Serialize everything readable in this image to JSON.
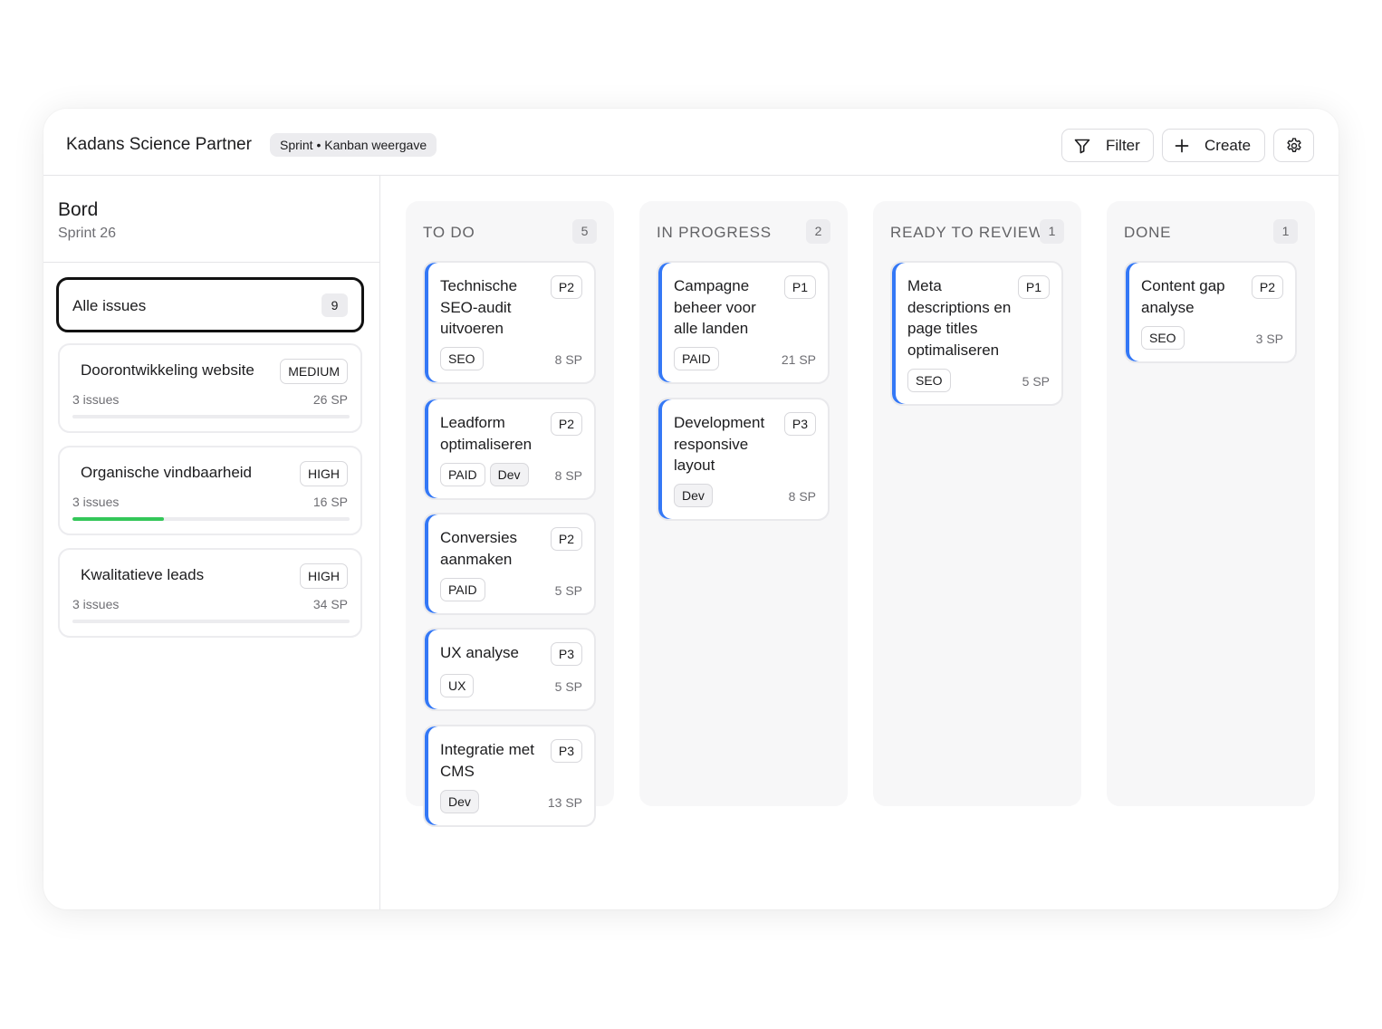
{
  "header": {
    "app_title": "Kadans Science Partner",
    "view_badge": "Sprint • Kanban weergave",
    "filter_label": "Filter",
    "create_label": "Create"
  },
  "sidebar": {
    "title": "Bord",
    "subtitle": "Sprint 26",
    "all_issues": {
      "label": "Alle issues",
      "count": "9"
    },
    "epics": [
      {
        "name": "Doorontwikkeling website",
        "priority": "MEDIUM",
        "issues": "3 issues",
        "sp": "26 SP",
        "progress": 0.0
      },
      {
        "name": "Organische vindbaarheid",
        "priority": "HIGH",
        "issues": "3 issues",
        "sp": "16 SP",
        "progress": 0.33
      },
      {
        "name": "Kwalitatieve leads",
        "priority": "HIGH",
        "issues": "3 issues",
        "sp": "34 SP",
        "progress": 0.0
      }
    ]
  },
  "board": {
    "accent_color": "#3478f6",
    "progress_color": "#34c759",
    "columns": [
      {
        "title": "TO DO",
        "count": "5",
        "cards": [
          {
            "title": "Technische SEO-audit uitvoeren",
            "priority": "P2",
            "tags": [
              "SEO"
            ],
            "sp": "8 SP"
          },
          {
            "title": "Leadform optimaliseren",
            "priority": "P2",
            "tags": [
              "PAID",
              "Dev"
            ],
            "sp": "8 SP"
          },
          {
            "title": "Conversies aanmaken",
            "priority": "P2",
            "tags": [
              "PAID"
            ],
            "sp": "5 SP"
          },
          {
            "title": "UX analyse",
            "priority": "P3",
            "tags": [
              "UX"
            ],
            "sp": "5 SP"
          },
          {
            "title": "Integratie met CMS",
            "priority": "P3",
            "tags": [
              "Dev"
            ],
            "sp": "13 SP"
          }
        ]
      },
      {
        "title": "IN PROGRESS",
        "count": "2",
        "cards": [
          {
            "title": "Campagne beheer voor alle landen",
            "priority": "P1",
            "tags": [
              "PAID"
            ],
            "sp": "21 SP"
          },
          {
            "title": "Development responsive layout",
            "priority": "P3",
            "tags": [
              "Dev"
            ],
            "sp": "8 SP"
          }
        ]
      },
      {
        "title": "READY TO REVIEW",
        "count": "1",
        "cards": [
          {
            "title": "Meta descriptions en page titles optimaliseren",
            "priority": "P1",
            "tags": [
              "SEO"
            ],
            "sp": "5 SP"
          }
        ]
      },
      {
        "title": "DONE",
        "count": "1",
        "cards": [
          {
            "title": "Content gap analyse",
            "priority": "P2",
            "tags": [
              "SEO"
            ],
            "sp": "3 SP"
          }
        ]
      }
    ]
  }
}
